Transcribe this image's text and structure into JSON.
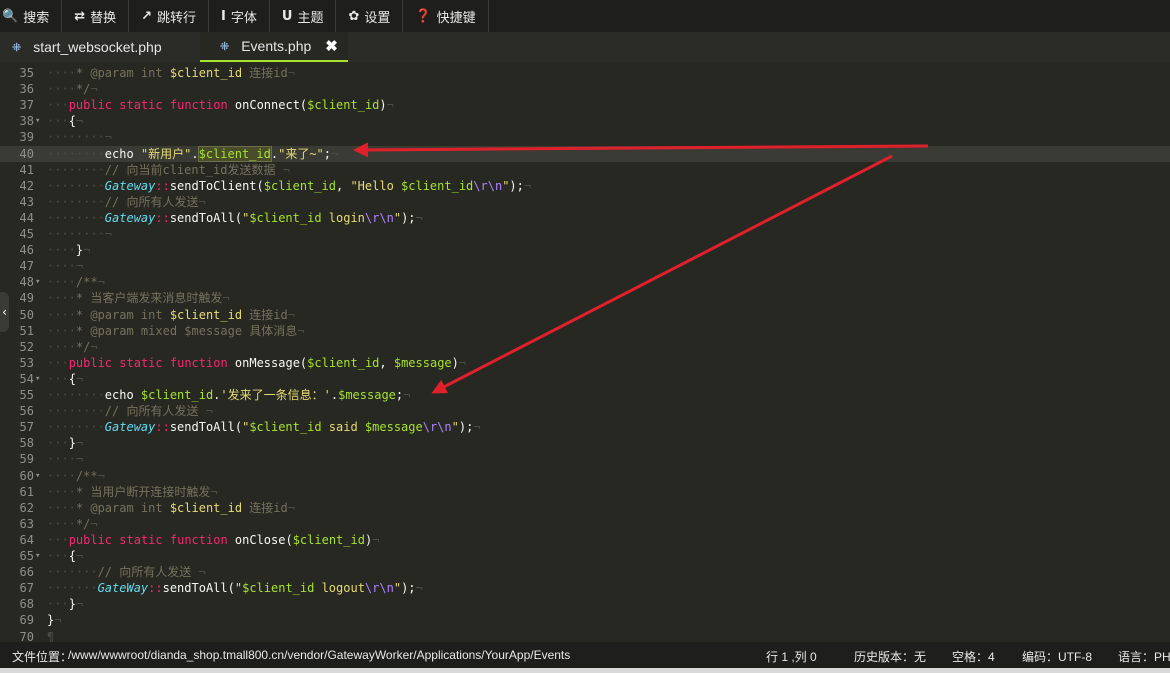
{
  "toolbar": {
    "items": [
      {
        "icon": "search-icon",
        "glyph": "🔍",
        "label": "搜索"
      },
      {
        "icon": "replace-icon",
        "glyph": "⇄",
        "label": "替换"
      },
      {
        "icon": "goto-line-icon",
        "glyph": "↗",
        "label": "跳转行"
      },
      {
        "icon": "font-icon",
        "glyph": "I",
        "label": "字体"
      },
      {
        "icon": "theme-icon",
        "glyph": "U",
        "label": "主题"
      },
      {
        "icon": "gear-icon",
        "glyph": "✿",
        "label": "设置"
      },
      {
        "icon": "help-icon",
        "glyph": "❓",
        "label": "快捷键"
      }
    ]
  },
  "tabs": [
    {
      "label": "start_websocket.php",
      "icon": "php-file-icon",
      "active": false
    },
    {
      "label": "Events.php",
      "icon": "php-file-icon",
      "active": true,
      "close": "✖"
    }
  ],
  "editor": {
    "lines": [
      {
        "n": "35",
        "f": ""
      },
      {
        "n": "36",
        "f": ""
      },
      {
        "n": "37",
        "f": ""
      },
      {
        "n": "38",
        "f": "▾"
      },
      {
        "n": "39",
        "f": ""
      },
      {
        "n": "40",
        "f": ""
      },
      {
        "n": "41",
        "f": ""
      },
      {
        "n": "42",
        "f": ""
      },
      {
        "n": "43",
        "f": ""
      },
      {
        "n": "44",
        "f": ""
      },
      {
        "n": "45",
        "f": ""
      },
      {
        "n": "46",
        "f": ""
      },
      {
        "n": "47",
        "f": ""
      },
      {
        "n": "48",
        "f": "▾"
      },
      {
        "n": "49",
        "f": ""
      },
      {
        "n": "50",
        "f": ""
      },
      {
        "n": "51",
        "f": ""
      },
      {
        "n": "52",
        "f": ""
      },
      {
        "n": "53",
        "f": ""
      },
      {
        "n": "54",
        "f": "▾"
      },
      {
        "n": "55",
        "f": ""
      },
      {
        "n": "56",
        "f": ""
      },
      {
        "n": "57",
        "f": ""
      },
      {
        "n": "58",
        "f": ""
      },
      {
        "n": "59",
        "f": ""
      },
      {
        "n": "60",
        "f": "▾"
      },
      {
        "n": "61",
        "f": ""
      },
      {
        "n": "62",
        "f": ""
      },
      {
        "n": "63",
        "f": ""
      },
      {
        "n": "64",
        "f": ""
      },
      {
        "n": "65",
        "f": "▾"
      },
      {
        "n": "66",
        "f": ""
      },
      {
        "n": "67",
        "f": ""
      },
      {
        "n": "68",
        "f": ""
      },
      {
        "n": "69",
        "f": ""
      },
      {
        "n": "70",
        "f": ""
      }
    ],
    "highlighted_line": "40",
    "tokens": {
      "l35": [
        "····",
        "* @param int ",
        "$client_id",
        " 连接id",
        "¬"
      ],
      "l36": [
        "····",
        "*/",
        "¬"
      ],
      "l37": [
        "···",
        "public",
        " ",
        "static",
        " ",
        "function",
        " onConnect(",
        "$client_id",
        ")",
        "¬"
      ],
      "l38": [
        "···",
        "{",
        "¬"
      ],
      "l39": [
        "········",
        "¬"
      ],
      "l40": [
        "········",
        "echo ",
        "\"新用户\"",
        ".",
        "$client_id",
        ".",
        "\"来了~\"",
        ";",
        "¬"
      ],
      "l41": [
        "········",
        "// 向当前client_id发送数据 ",
        "¬"
      ],
      "l42": [
        "········",
        "Gateway",
        "::",
        "sendToClient(",
        "$client_id",
        ", ",
        "\"Hello ",
        "$client_id",
        "\\r\\n",
        "\"",
        ");",
        "¬"
      ],
      "l43": [
        "········",
        "// 向所有人发送",
        "¬"
      ],
      "l44": [
        "········",
        "Gateway",
        "::",
        "sendToAll(",
        "\"",
        "$client_id",
        " login",
        "\\r\\n",
        "\"",
        ");",
        "¬"
      ],
      "l45": [
        "········",
        "¬"
      ],
      "l46": [
        "····",
        "}",
        "¬"
      ],
      "l47": [
        "····",
        "¬"
      ],
      "l48": [
        "····",
        "/**",
        "¬"
      ],
      "l49": [
        "····",
        "* 当客户端发来消息时触发",
        "¬"
      ],
      "l50": [
        "····",
        "* @param int ",
        "$client_id",
        " 连接id",
        "¬"
      ],
      "l51": [
        "····",
        "* @param mixed $message 具体消息",
        "¬"
      ],
      "l52": [
        "····",
        "*/",
        "¬"
      ],
      "l53": [
        "···",
        "public",
        " ",
        "static",
        " ",
        "function",
        " onMessage(",
        "$client_id",
        ", ",
        "$message",
        ")",
        "¬"
      ],
      "l54": [
        "···",
        "{",
        "¬"
      ],
      "l55": [
        "········",
        "echo ",
        "$client_id",
        ".",
        "'发来了一条信息：'",
        ".",
        "$message",
        ";",
        "¬"
      ],
      "l56": [
        "········",
        "// 向所有人发送 ",
        "¬"
      ],
      "l57": [
        "········",
        "Gateway",
        "::",
        "sendToAll(",
        "\"",
        "$client_id",
        " said ",
        "$message",
        "\\r\\n",
        "\"",
        ");",
        "¬"
      ],
      "l58": [
        "···",
        "}",
        "¬"
      ],
      "l59": [
        "····",
        "¬"
      ],
      "l60": [
        "····",
        "/**",
        "¬"
      ],
      "l61": [
        "····",
        "* 当用户断开连接时触发",
        "¬"
      ],
      "l62": [
        "····",
        "* @param int ",
        "$client_id",
        " 连接id",
        "¬"
      ],
      "l63": [
        "····",
        "*/",
        "¬"
      ],
      "l64": [
        "···",
        "public",
        " ",
        "static",
        " ",
        "function",
        " onClose(",
        "$client_id",
        ")",
        "¬"
      ],
      "l65": [
        "···",
        "{",
        "¬"
      ],
      "l66": [
        "·······",
        "// 向所有人发送 ",
        "¬"
      ],
      "l67": [
        "·······",
        "GateWay",
        "::",
        "sendToAll(",
        "\"",
        "$client_id",
        " logout",
        "\\r\\n",
        "\"",
        ");",
        "¬"
      ],
      "l68": [
        "···",
        "}",
        "¬"
      ],
      "l69": [
        "",
        "}",
        "¬"
      ],
      "l70": [
        "",
        "¶"
      ]
    }
  },
  "statusbar": {
    "path_label": "文件位置：",
    "path": "/www/wwwroot/dianda_shop.tmall800.cn/vendor/GatewayWorker/Applications/YourApp/Events",
    "position": "行 1 ,列 0",
    "history": "历史版本：无",
    "indent": "空格：4",
    "encoding": "编码：UTF-8",
    "language": "语言：PH"
  },
  "sidebar_toggle": "‹",
  "colors": {
    "background": "#272822",
    "keyword": "#f92672",
    "variable": "#e6db74",
    "class": "#66d9ef",
    "comment": "#75715e",
    "arrow": "#e0202a"
  }
}
